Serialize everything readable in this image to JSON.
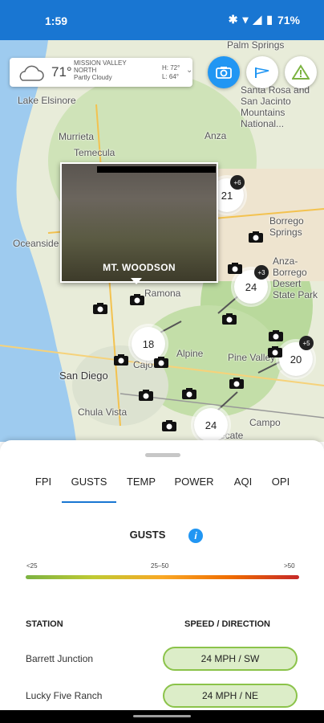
{
  "status": {
    "time": "1:59",
    "battery": "71%"
  },
  "weather": {
    "temp": "71",
    "location": "MISSION VALLEY NORTH",
    "condition": "Partly Cloudy",
    "high": "H: 72",
    "low": "L: 64"
  },
  "map_labels": [
    {
      "id": "palm-springs",
      "text": "Palm Springs"
    },
    {
      "id": "santa-rosa",
      "text": "Santa Rosa and San Jacinto Mountains National..."
    },
    {
      "id": "lake-elsinore",
      "text": "Lake Elsinore"
    },
    {
      "id": "murrieta",
      "text": "Murrieta"
    },
    {
      "id": "temecula",
      "text": "Temecula"
    },
    {
      "id": "anza",
      "text": "Anza"
    },
    {
      "id": "borrego",
      "text": "Borrego Springs"
    },
    {
      "id": "anza-borrego",
      "text": "Anza-Borrego Desert State Park"
    },
    {
      "id": "oceanside",
      "text": "Oceanside"
    },
    {
      "id": "ramona",
      "text": "Ramona"
    },
    {
      "id": "alpine",
      "text": "Alpine"
    },
    {
      "id": "pine-valley",
      "text": "Pine Valley"
    },
    {
      "id": "san-diego",
      "text": "San Diego"
    },
    {
      "id": "chula-vista",
      "text": "Chula Vista"
    },
    {
      "id": "campo",
      "text": "Campo"
    },
    {
      "id": "tecate",
      "text": "Tecate"
    },
    {
      "id": "cajon",
      "text": "Cajo"
    }
  ],
  "clusters": [
    {
      "id": "21",
      "value": "21",
      "plus": "+6"
    },
    {
      "id": "24a",
      "value": "24",
      "plus": "+3"
    },
    {
      "id": "18",
      "value": "18",
      "plus": ""
    },
    {
      "id": "20",
      "value": "20",
      "plus": "+5"
    },
    {
      "id": "24b",
      "value": "24",
      "plus": ""
    }
  ],
  "popup": {
    "caption": "MT. WOODSON"
  },
  "tabs": [
    "FPI",
    "GUSTS",
    "TEMP",
    "POWER",
    "AQI",
    "OPI"
  ],
  "active_tab": "GUSTS",
  "section": {
    "title": "GUSTS",
    "info_icon": "i"
  },
  "legend": {
    "low": "<25",
    "mid": "25–50",
    "high": ">50"
  },
  "table": {
    "col_station": "STATION",
    "col_speed": "SPEED / DIRECTION",
    "rows": [
      {
        "station": "Barrett Junction",
        "value": "24 MPH / SW"
      },
      {
        "station": "Lucky Five Ranch",
        "value": "24 MPH / NE"
      }
    ]
  },
  "colors": {
    "accent": "#1976d2",
    "active_pill_bg": "#dcedc8",
    "active_pill_border": "#8bc34a"
  }
}
